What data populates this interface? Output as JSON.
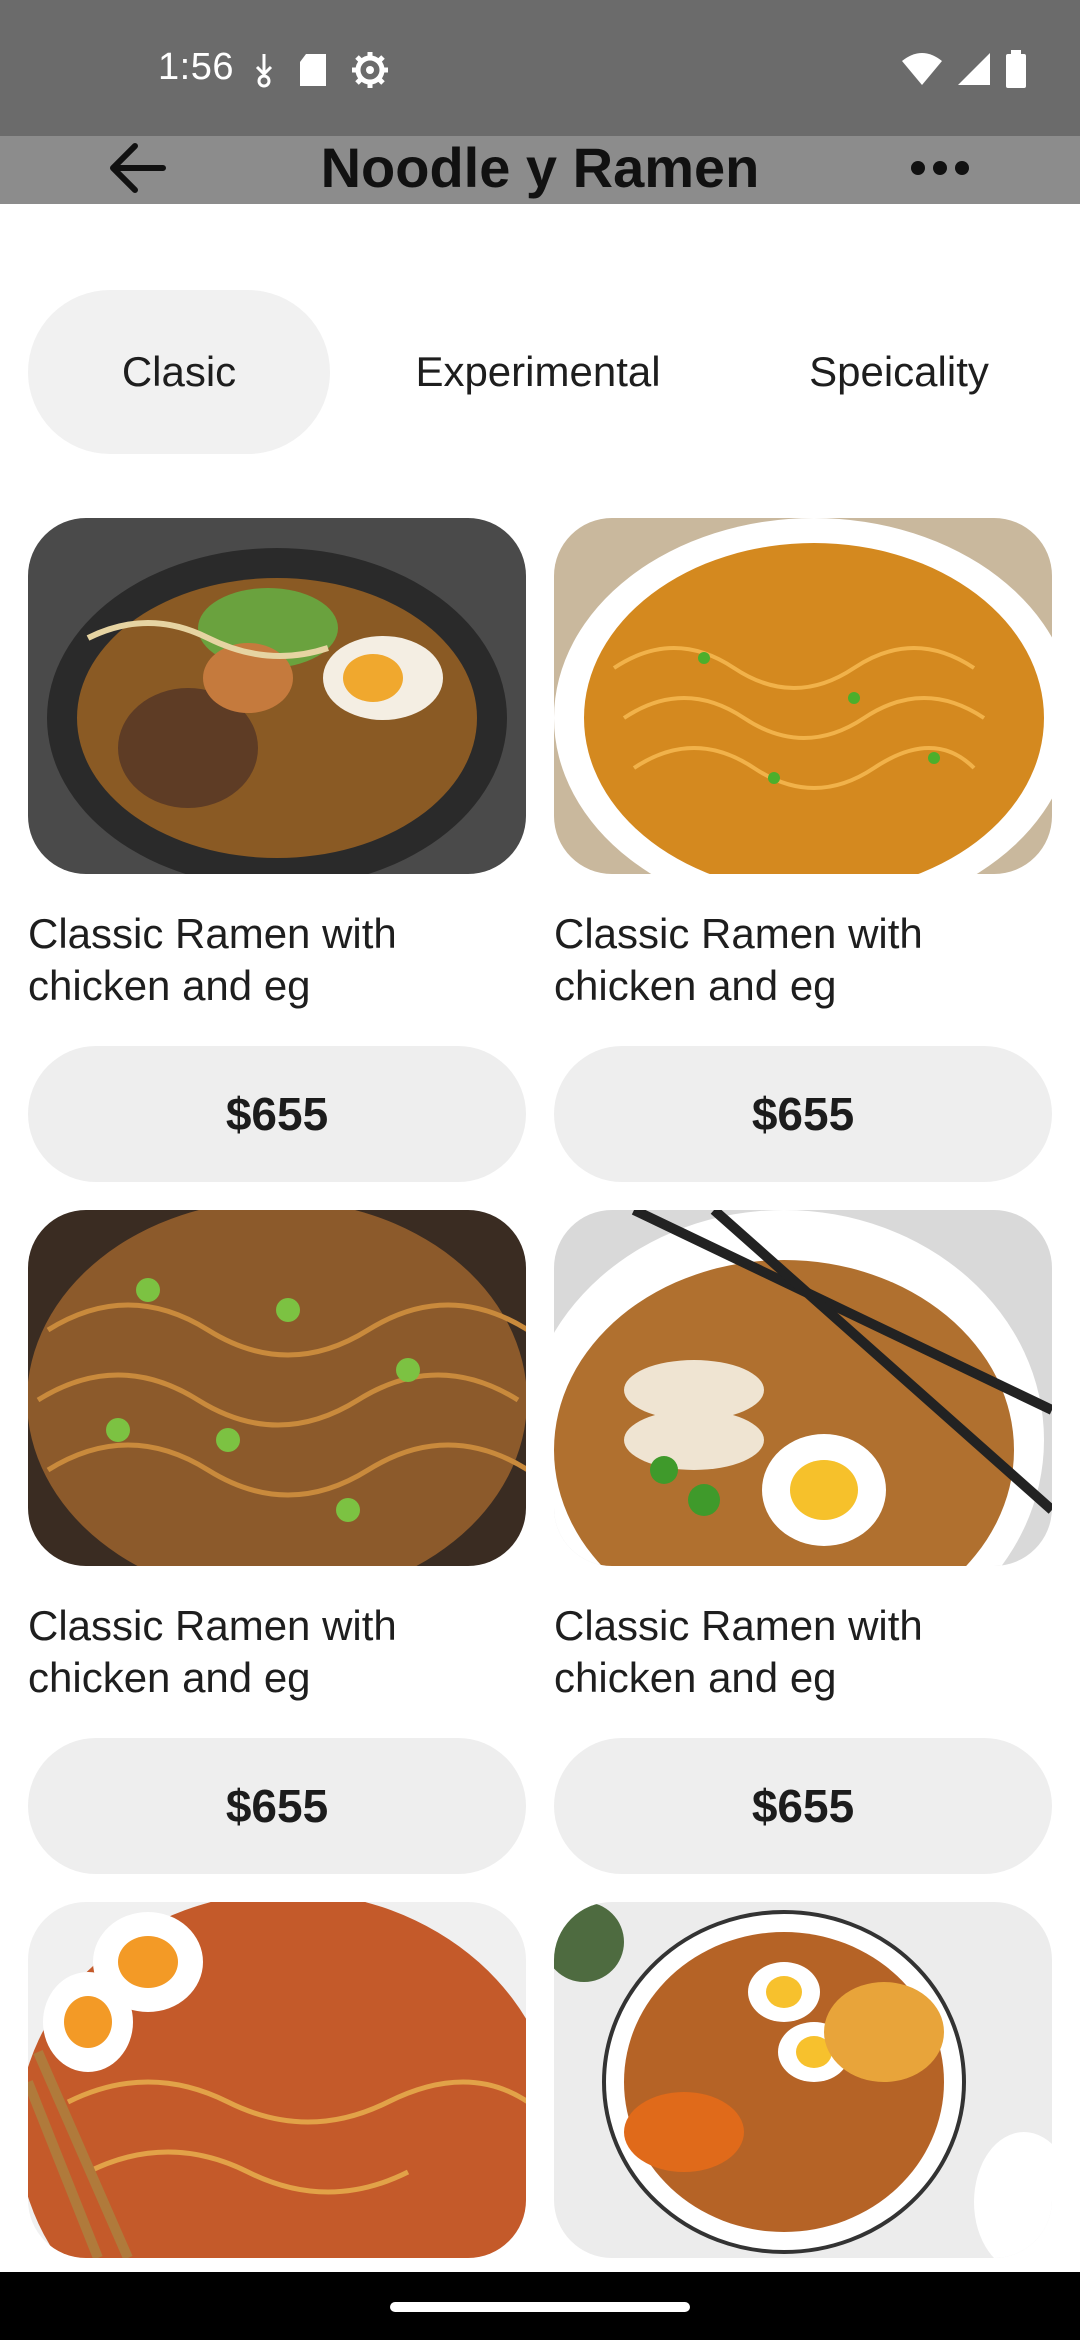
{
  "status_bar": {
    "time": "1:56",
    "icons": [
      "download-status-icon",
      "sd-card-icon",
      "settings-gear-icon",
      "wifi-icon",
      "signal-icon",
      "battery-icon"
    ]
  },
  "app_bar": {
    "title": "Noodle y Ramen",
    "back_icon": "arrow-left-icon",
    "more_icon": "more-horizontal-icon"
  },
  "tabs": [
    {
      "label": "Clasic",
      "selected": true
    },
    {
      "label": "Experimental",
      "selected": false
    },
    {
      "label": "Speicality",
      "selected": false
    }
  ],
  "products": [
    {
      "title": "Classic Ramen with chicken and eg",
      "price": "$655"
    },
    {
      "title": "Classic Ramen with chicken and eg",
      "price": "$655"
    },
    {
      "title": "Classic Ramen with chicken and eg",
      "price": "$655"
    },
    {
      "title": "Classic Ramen with chicken and eg",
      "price": "$655"
    }
  ],
  "colors": {
    "status_bar_bg": "#6b6b6b",
    "app_bar_bg": "#8c8c8c",
    "tab_selected_bg": "#f1f1f1",
    "price_button_bg": "#eeeeee"
  }
}
